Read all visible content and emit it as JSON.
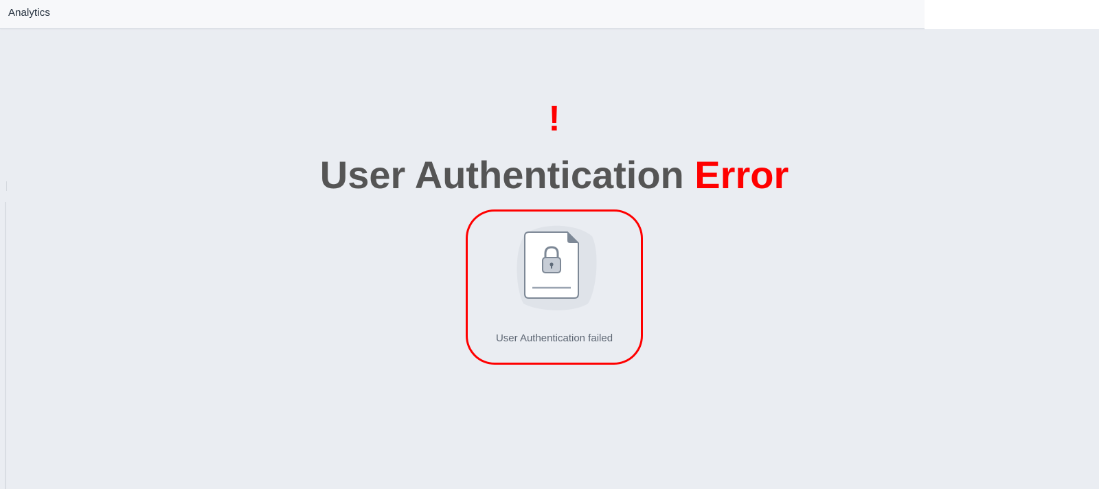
{
  "app": {
    "title": "Analytics"
  },
  "error": {
    "symbol": "!",
    "heading_main": "User Authentication",
    "heading_accent": "Error",
    "accent_color": "#ff0000",
    "message": "User Authentication failed",
    "icon": "locked-document-icon"
  }
}
